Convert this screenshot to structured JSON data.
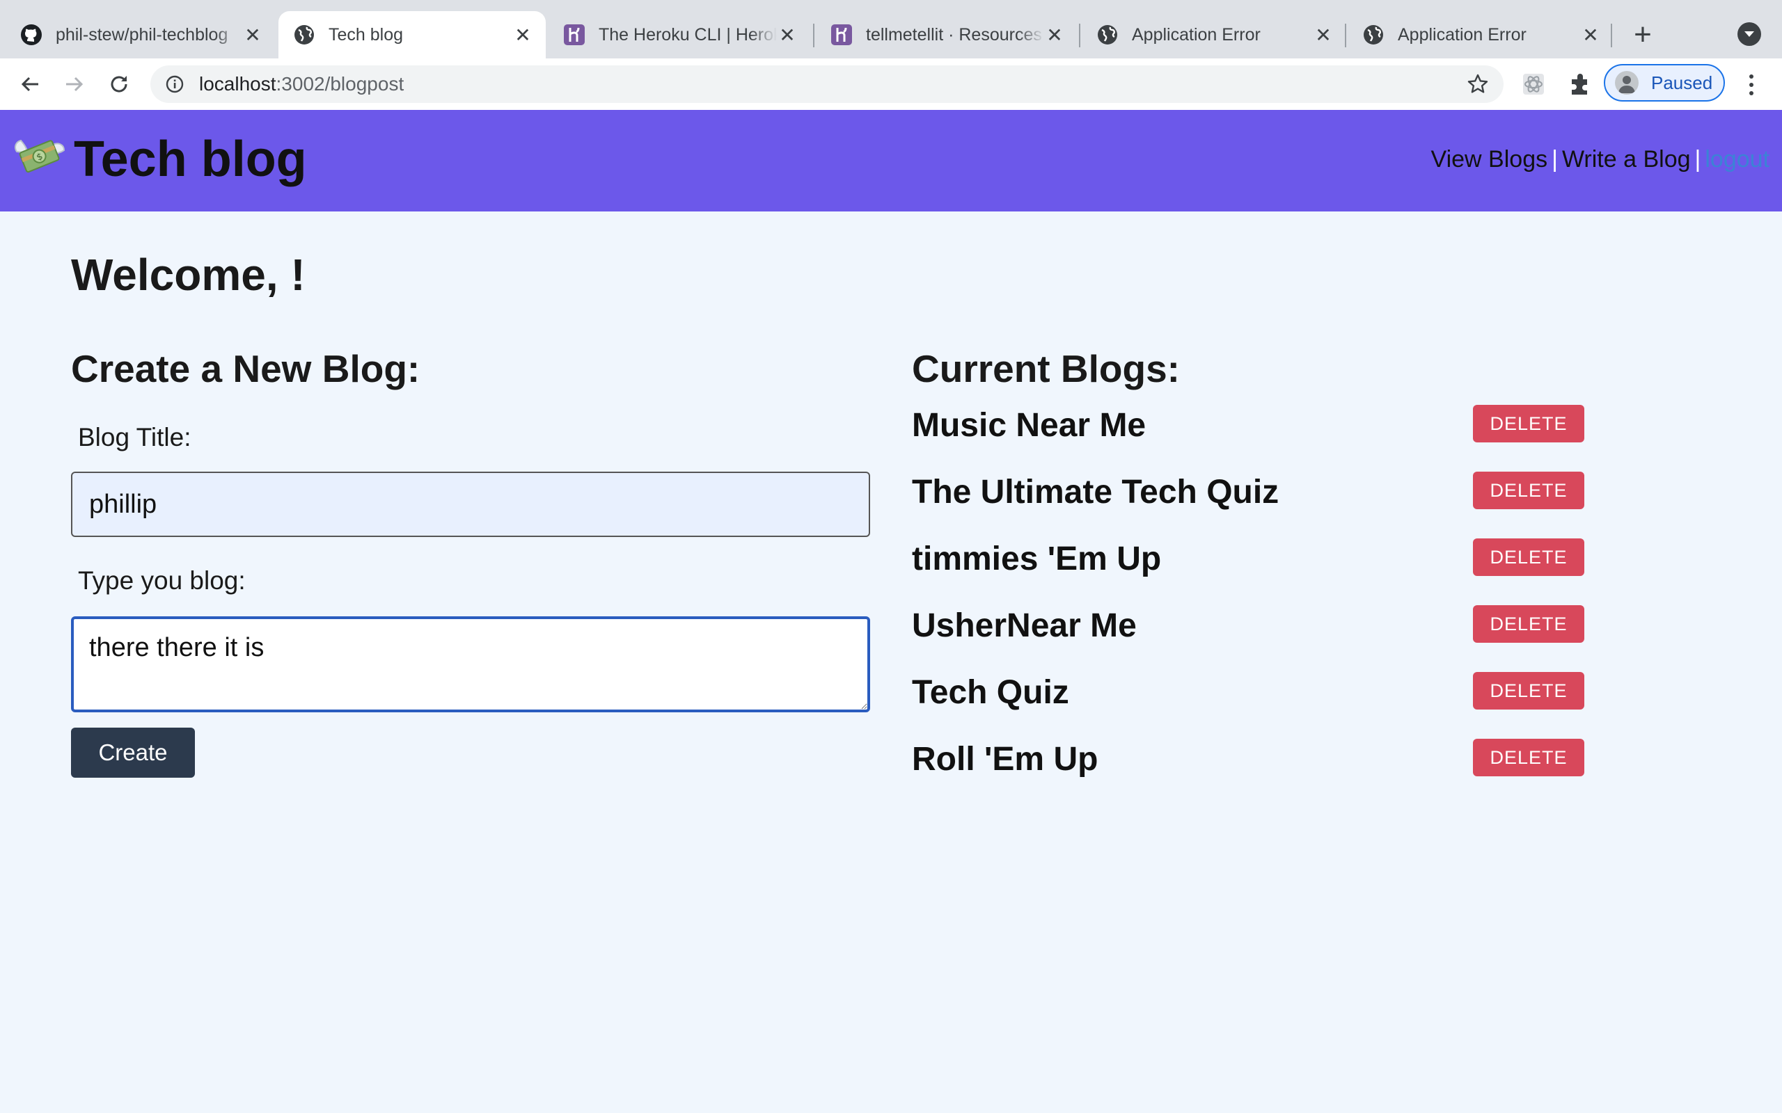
{
  "browser": {
    "tabs": [
      {
        "title": "phil-stew/phil-techblog",
        "icon": "github-icon",
        "active": false
      },
      {
        "title": "Tech blog",
        "icon": "globe-icon",
        "active": true
      },
      {
        "title": "The Heroku CLI | Heroku",
        "icon": "heroku-icon",
        "active": false
      },
      {
        "title": "tellmetellit · Resources",
        "icon": "heroku-icon",
        "active": false
      },
      {
        "title": "Application Error",
        "icon": "globe-icon",
        "active": false
      },
      {
        "title": "Application Error",
        "icon": "globe-icon",
        "active": false
      }
    ],
    "close_glyph": "✕",
    "new_tab_glyph": "+",
    "url_host": "localhost",
    "url_path": ":3002/blogpost",
    "profile_label": "Paused"
  },
  "site": {
    "title": "Tech blog",
    "nav": {
      "view_blogs": "View Blogs",
      "separator": "|",
      "write_blog": "Write a Blog",
      "logout": "logout"
    }
  },
  "main": {
    "welcome": "Welcome, !",
    "create_heading": "Create a New Blog:",
    "title_label": "Blog Title:",
    "title_value": "phillip",
    "body_label": "Type you blog:",
    "body_value": "there there it is",
    "create_button": "Create",
    "current_heading": "Current Blogs:",
    "delete_label": "DELETE",
    "blogs": [
      "Music Near Me",
      "The Ultimate Tech Quiz",
      "timmies 'Em Up",
      "UsherNear Me",
      "Tech Quiz",
      "Roll 'Em Up"
    ]
  },
  "colors": {
    "header_bg": "#6c58ea",
    "page_bg": "#f0f6fd",
    "delete_bg": "#d8485b",
    "create_bg": "#2c3a4d",
    "logout_link": "#3b83d6"
  }
}
